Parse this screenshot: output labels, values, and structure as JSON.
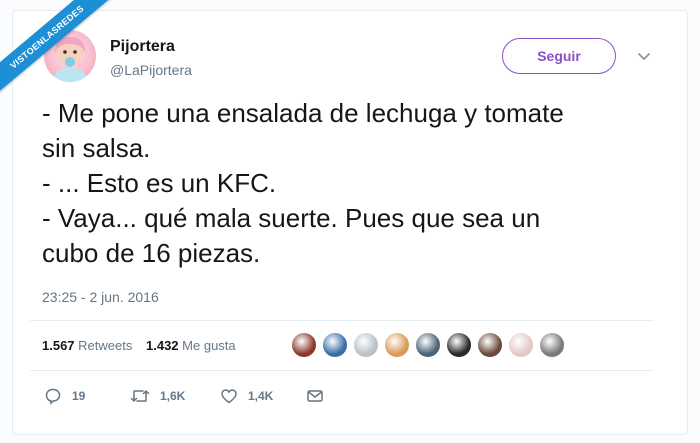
{
  "watermark": {
    "text": "VISTOENLASREDES"
  },
  "author": {
    "display_name": "Pijortera",
    "handle": "@LaPijortera",
    "follow_label": "Seguir",
    "accent": "#8b50c8"
  },
  "tweet": {
    "text": "- Me pone una ensalada de lechuga y tomate\nsin salsa.\n- ... Esto es un KFC.\n- Vaya... qué mala suerte. Pues que sea un\ncubo de 16 piezas.",
    "timestamp": "23:25 - 2 jun. 2016"
  },
  "stats": {
    "retweets_count": "1.567",
    "retweets_label": "Retweets",
    "likes_count": "1.432",
    "likes_label": "Me gusta",
    "liker_avatars": [
      "#8a3a2b",
      "#3a6ea8",
      "#b8c0c8",
      "#d99a55",
      "#4b6477",
      "#2a2a2a",
      "#6b4a3d",
      "#e5c8c5",
      "#7a7a7a"
    ]
  },
  "actions": {
    "replies": "19",
    "retweets": "1,6K",
    "likes": "1,4K",
    "icons": [
      "reply-icon",
      "retweet-icon",
      "like-icon",
      "message-icon"
    ]
  }
}
